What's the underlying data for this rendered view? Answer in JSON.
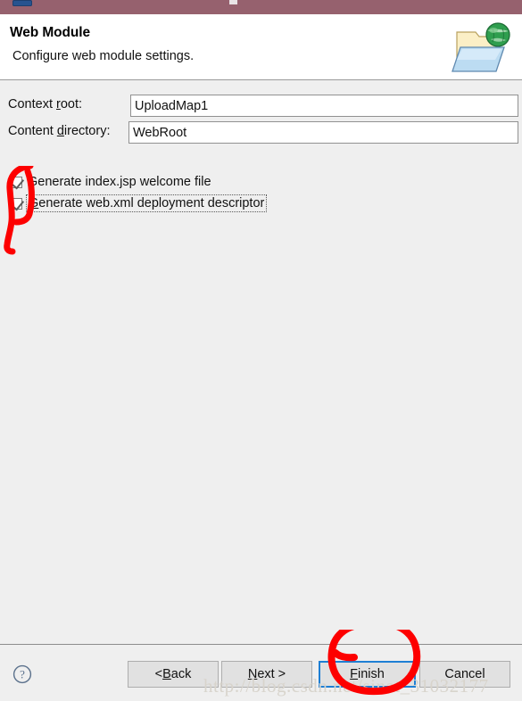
{
  "window": {
    "titlebar_color": "#96616e",
    "body_color": "#efefef"
  },
  "header": {
    "title": "Web Module",
    "subtitle": "Configure web module settings.",
    "icon": "folder-globe-icon"
  },
  "form": {
    "fields": [
      {
        "name": "context-root",
        "label_prefix": "Context ",
        "label_mnemonic": "r",
        "label_suffix": "oot:",
        "value": "UploadMap1",
        "placeholder": ""
      },
      {
        "name": "content-directory",
        "label_prefix": "Content ",
        "label_mnemonic": "d",
        "label_suffix": "irectory:",
        "value": "WebRoot",
        "placeholder": ""
      }
    ]
  },
  "options": {
    "checkboxes": [
      {
        "name": "generate-index-jsp",
        "label_prefix": "G",
        "label_mnemonic": "",
        "label_suffix": "enerate index.jsp welcome file",
        "checked": true,
        "focused": false
      },
      {
        "name": "generate-web-xml",
        "label_prefix": "",
        "label_mnemonic": "G",
        "label_suffix": "enerate web.xml deployment descriptor",
        "checked": true,
        "focused": true
      }
    ]
  },
  "footer": {
    "help_icon": "help-question-icon",
    "buttons": [
      {
        "name": "back",
        "prefix": "< ",
        "mnemonic": "B",
        "suffix": "ack",
        "default": false
      },
      {
        "name": "next",
        "prefix": "",
        "mnemonic": "N",
        "suffix": "ext >",
        "default": false
      },
      {
        "name": "finish",
        "prefix": "",
        "mnemonic": "F",
        "suffix": "inish",
        "default": true
      },
      {
        "name": "cancel",
        "prefix": "",
        "mnemonic": "",
        "suffix": "Cancel",
        "default": false
      }
    ],
    "focus_color": "#1e7fd4"
  },
  "watermark": {
    "text": "http://blog.csdn.net/sinat_31032177",
    "color": "#d8d4cc"
  },
  "annotations": {
    "color": "#fd0000",
    "items": [
      {
        "name": "checkbox-bracket-annotation",
        "shape": "hand-drawn-bracket"
      },
      {
        "name": "finish-circle-annotation",
        "shape": "hand-drawn-circle"
      }
    ]
  }
}
